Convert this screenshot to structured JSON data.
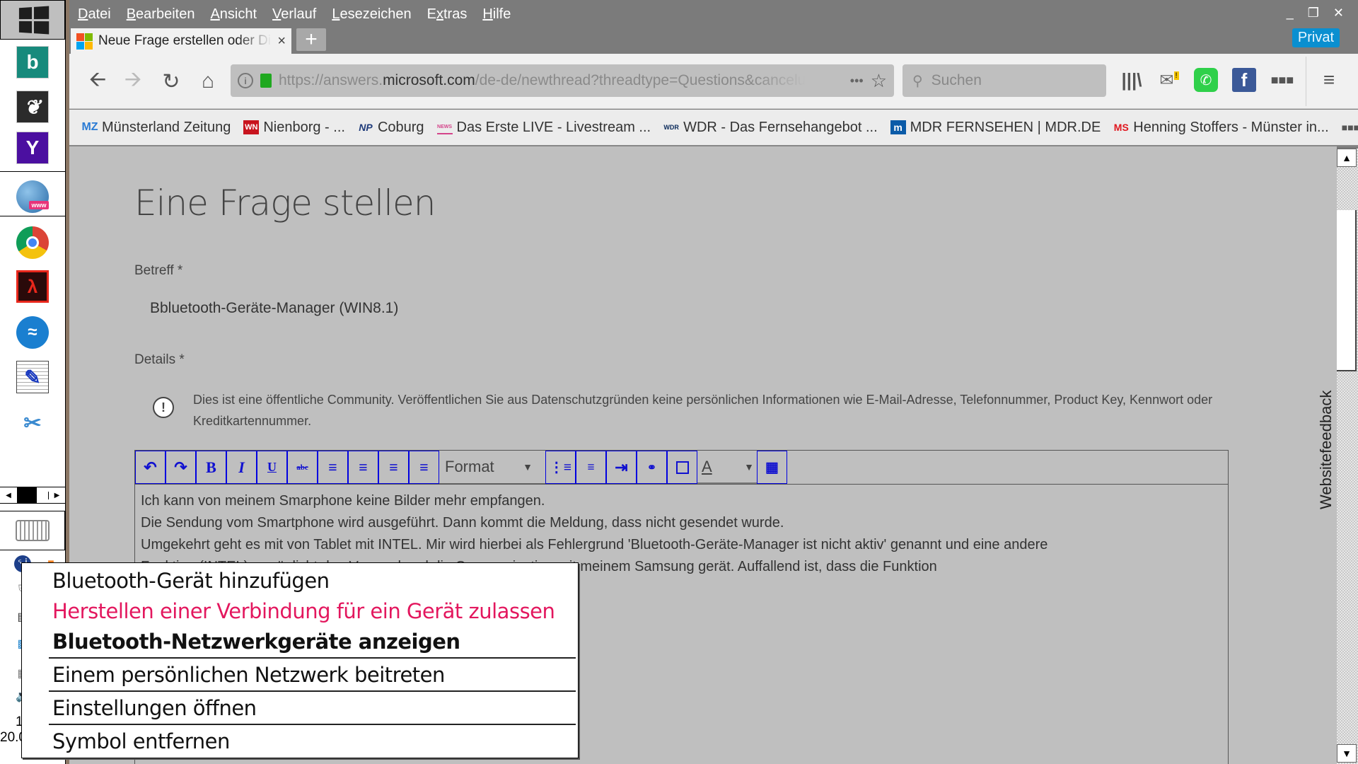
{
  "menubar": {
    "items": [
      {
        "label": "Datei",
        "accel": "D"
      },
      {
        "label": "Bearbeiten",
        "accel": "B"
      },
      {
        "label": "Ansicht",
        "accel": "A"
      },
      {
        "label": "Verlauf",
        "accel": "V"
      },
      {
        "label": "Lesezeichen",
        "accel": "L"
      },
      {
        "label": "Extras",
        "accel": "x"
      },
      {
        "label": "Hilfe",
        "accel": "H"
      }
    ]
  },
  "window_controls": {
    "minimize": "_",
    "restore": "❐",
    "close": "✕"
  },
  "private_badge": "Privat",
  "tab": {
    "title": "Neue Frage erstellen oder Diskussion starten",
    "close": "×",
    "new_tab": "+"
  },
  "urlbar": {
    "prefix": "https://answers.",
    "domain": "microsoft.com",
    "suffix": "/de-de/newthread?threadtype=Questions&cancelurl=",
    "more": "•••",
    "star": "☆"
  },
  "searchbar": {
    "placeholder": "Suchen"
  },
  "bookmarks": [
    {
      "label": "Münsterland Zeitung",
      "favicon": "MZ",
      "color": "#2a7bd4"
    },
    {
      "label": "Nienborg - ...",
      "favicon": "WN",
      "color": "#c8141e"
    },
    {
      "label": "Coburg",
      "favicon": "NP",
      "color": "#1f3b7a"
    },
    {
      "label": "Das Erste LIVE - Livestream ...",
      "favicon": "NEWS",
      "color": "#d4448a"
    },
    {
      "label": "WDR - Das Fernsehangebot ...",
      "favicon": "WDR",
      "color": "#0a2a5a"
    },
    {
      "label": "MDR FERNSEHEN | MDR.DE",
      "favicon": "m",
      "color": "#0b5ba8"
    },
    {
      "label": "Henning Stoffers - Münster in...",
      "favicon": "MS",
      "color": "#e0161e"
    }
  ],
  "bookmarks_overflow": "•••",
  "page": {
    "title": "Eine Frage stellen",
    "subject_label": "Betreff *",
    "subject_value": "Bbluetooth-Geräte-Manager (WIN8.1)",
    "details_label": "Details *",
    "privacy_notice": "Dies ist eine öffentliche Community. Veröffentlichen Sie aus Datenschutzgründen keine persönlichen Informationen wie E-Mail-Adresse, Telefonnummer, Product Key, Kennwort oder Kreditkartennummer.",
    "feedback_tab": "Websitefeedback"
  },
  "editor": {
    "format_label": "Format",
    "tools": [
      "undo",
      "redo",
      "bold",
      "italic",
      "underline",
      "strikethrough",
      "align-left",
      "align-center",
      "align-right",
      "justify"
    ],
    "tools2": [
      "bullet-list",
      "numbered-list",
      "indent",
      "link",
      "image"
    ],
    "lines": [
      "Ich kann von meinem Smarphone keine Bilder mehr empfangen.",
      "Die Sendung vom Smartphone wird ausgeführt. Dann kommt die Meldung, dass nicht gesendet wurde.",
      "Umgekehrt geht es mit von Tablet mit INTEL. Mir wird hierbei als Fehlergrund 'Bluetooth-Geräte-Manager ist nicht aktiv' genannt und eine andere",
      "Funktion (INTEL) ermöglicht den Versand und die Communication mit meinem Samsung gerät. Auffallend ist, dass die Funktion"
    ]
  },
  "context_menu": {
    "items": [
      {
        "label": "Bluetooth-Gerät hinzufügen",
        "style": "normal"
      },
      {
        "label": "Herstellen einer Verbindung für ein Gerät zulassen",
        "style": "highlight",
        "color": "#e3175e"
      },
      {
        "label": "Bluetooth-Netzwerkgeräte anzeigen",
        "style": "bold"
      },
      {
        "label": "Einem persönlichen Netzwerk beitreten",
        "style": "normal"
      },
      {
        "label": "Einstellungen öffnen",
        "style": "normal"
      },
      {
        "label": "Symbol entfernen",
        "style": "normal"
      }
    ]
  },
  "taskbar": {
    "apps": [
      "Bing",
      "Stardock",
      "Yahoo",
      "Web browser",
      "Google Chrome",
      "Adobe Acrobat Reader",
      "OpenOffice",
      "Notepad editor",
      "Snipping Tool"
    ],
    "clock_fragment": "1",
    "date_fragment": "20.0"
  }
}
